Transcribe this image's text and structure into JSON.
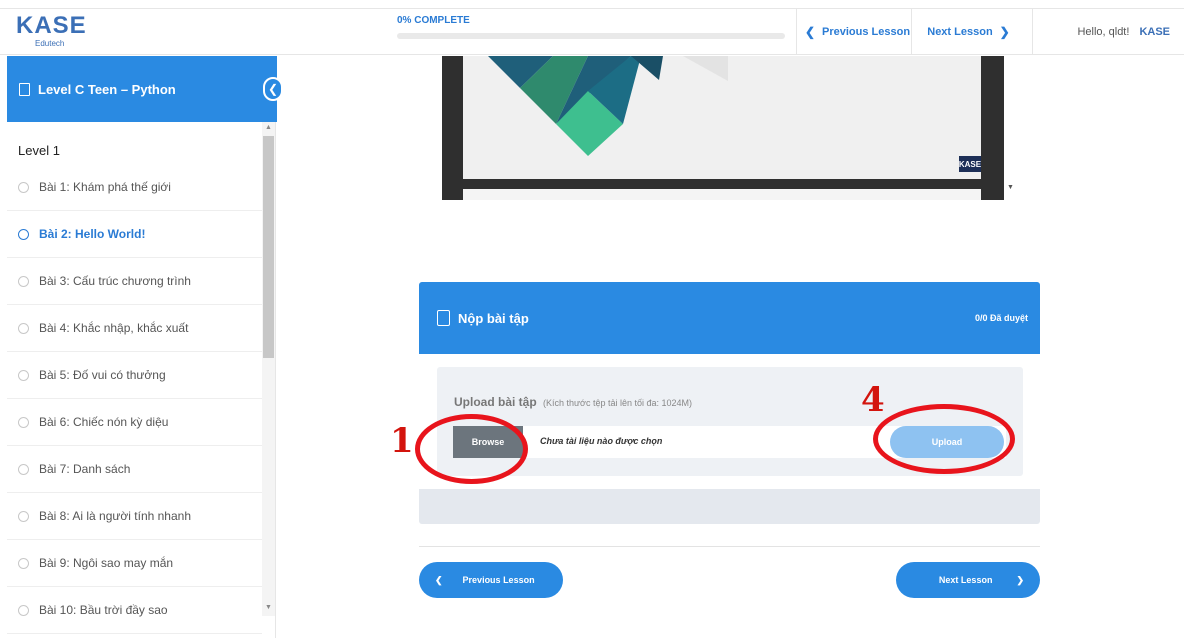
{
  "header": {
    "logo": {
      "brand": "KASE",
      "sub": "Edutech"
    },
    "progress": {
      "label": "0% COMPLETE",
      "percent": 0
    },
    "prev_label": "Previous Lesson",
    "next_label": "Next Lesson",
    "greeting": "Hello, qldt!",
    "mini_logo": "KASE"
  },
  "sidebar": {
    "course_title": "Level C Teen – Python",
    "level_title": "Level 1",
    "lessons": [
      {
        "label": "Bài 1: Khám phá thế giới",
        "active": false
      },
      {
        "label": "Bài 2: Hello World!",
        "active": true
      },
      {
        "label": "Bài 3: Cấu trúc chương trình",
        "active": false
      },
      {
        "label": "Bài 4: Khắc nhập, khắc xuất",
        "active": false
      },
      {
        "label": "Bài 5: Đố vui có thưởng",
        "active": false
      },
      {
        "label": "Bài 6: Chiếc nón kỳ diệu",
        "active": false
      },
      {
        "label": "Bài 7: Danh sách",
        "active": false
      },
      {
        "label": "Bài 8: Ai là người tính nhanh",
        "active": false
      },
      {
        "label": "Bài 9: Ngôi sao may mắn",
        "active": false
      },
      {
        "label": "Bài 10: Bầu trời đầy sao",
        "active": false
      }
    ]
  },
  "video": {
    "watermark": "KASE"
  },
  "submission": {
    "title": "Nộp bài tập",
    "status": "0/0 Đã duyệt",
    "upload_title": "Upload bài tập",
    "upload_hint": "(Kích thước tệp tải lên tối đa: 1024M)",
    "browse_label": "Browse",
    "file_status": "Chưa tài liệu nào được chọn",
    "upload_label": "Upload"
  },
  "footer_nav": {
    "prev_label": "Previous Lesson",
    "next_label": "Next Lesson"
  },
  "annotations": {
    "browse_marker": "1",
    "upload_marker": "4"
  },
  "colors": {
    "primary": "#2a8ae2",
    "annotation": "#e8141c",
    "upload_disabled": "#8ec2f1",
    "browse": "#6c757d"
  }
}
